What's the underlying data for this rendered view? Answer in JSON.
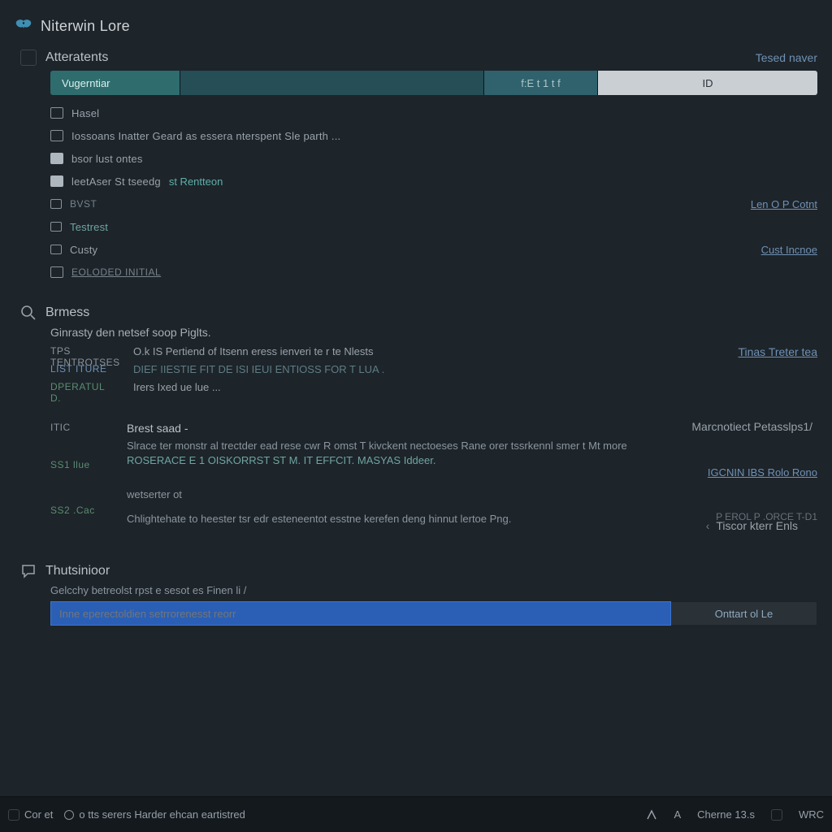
{
  "app": {
    "title": "Niterwin Lore"
  },
  "section1": {
    "title": "Atteratents",
    "right_meta": "Tesed naver",
    "tabs": {
      "a": "Vugerntiar",
      "b": "",
      "c": "f:E  t 1 t f",
      "d": "ID"
    },
    "rows": [
      {
        "label": "Hasel"
      },
      {
        "label": "Iossoans Inatter Geard as essera nterspent Sle parth ..."
      },
      {
        "label": "bsor lust ontes"
      },
      {
        "label": "leetAser St tseedg",
        "sublabel": "st Rentteon"
      },
      {
        "label": "bvst",
        "muted": true
      },
      {
        "label": "Testrest"
      },
      {
        "label": "Custy"
      },
      {
        "label": "EOLODED INITIAL"
      }
    ],
    "right_links": [
      "Len  O P Cotnt",
      "Cust  Incnoe"
    ]
  },
  "section2": {
    "title": "Brmess",
    "lead": "Ginrasty den netsef soop Piglts.",
    "side": [
      "tps tentrotses",
      "list Iture",
      "DPERATUL D."
    ],
    "lines": [
      "O.k IS Pertiend of Itsenn eress ienveri te r te Nlests",
      "DIEF IIESTIE FIT DE ISI IEUI ENTIOSS FOR  T LUA .",
      "Irers Ixed ue lue ..."
    ],
    "right_links": [
      "Tinas  Treter    tea"
    ],
    "right_meta": "Marcnotiect Petasslps1/",
    "block": {
      "labels": [
        "ITIC",
        "SS1 llue",
        "SS2 .Cac"
      ],
      "lead": "Brest saad -",
      "para": "Slrace ter monstr al trectder ead rese cwr R omst T kivckent nectoeses Rane orer tssrkennl smer t Mt  more",
      "code": "ROSERACE E 1 OISKORRST ST  M. IT EFFCIT. MASYAS Iddeer.",
      "ghost": "wetserter ot",
      "right_link": "IGCNIN IBS Rolo Rono",
      "right_link2": "  P EROL  P .ORCE     T-D1",
      "summary": "Chlightehate to heester tsr edr esteneentot esstne kerefen deng hinnut lertoe Png."
    }
  },
  "section3": {
    "title": "Thutsinioor",
    "prompt": "Gelcchy betreolst rpst e sesot es Finen li /",
    "input_placeholder": "Inne eperectoldien setrrorenesst reorr",
    "button": "Onttart ol Le",
    "lang_label": "Tiscor kterr  Enls"
  },
  "status": {
    "left_1": "Cor et",
    "left_2": "o tts serers Harder ehcan eartistred",
    "right": [
      "A",
      "Cherne 13.s",
      "WRC"
    ]
  }
}
